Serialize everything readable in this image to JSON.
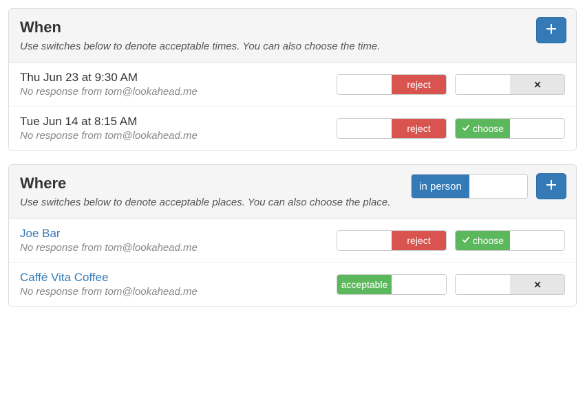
{
  "when": {
    "title": "When",
    "subtitle": "Use switches below to denote acceptable times.  You can also choose the time.",
    "items": [
      {
        "title": "Thu Jun 23 at 9:30 AM",
        "sub": "No response from tom@lookahead.me",
        "left": {
          "blank": "",
          "label": "reject",
          "color": "red"
        },
        "right": {
          "blank": "",
          "label": "✕",
          "color": "gray",
          "icon": "x"
        }
      },
      {
        "title": "Tue Jun 14 at 8:15 AM",
        "sub": "No response from tom@lookahead.me",
        "left": {
          "blank": "",
          "label": "reject",
          "color": "red"
        },
        "right": {
          "label": "choose",
          "blank": "",
          "color": "green",
          "icon": "check"
        }
      }
    ]
  },
  "where": {
    "title": "Where",
    "subtitle": "Use switches below to denote acceptable places.  You can also choose the place.",
    "mode_left": "in person",
    "mode_right": "",
    "items": [
      {
        "title": "Joe Bar",
        "sub": "No response from tom@lookahead.me",
        "left": {
          "blank": "",
          "label": "reject",
          "color": "red"
        },
        "right": {
          "label": "choose",
          "blank": "",
          "color": "green",
          "icon": "check"
        }
      },
      {
        "title": "Caffé Vita Coffee",
        "sub": "No response from tom@lookahead.me",
        "left": {
          "label": "acceptable",
          "blank": "",
          "color": "green"
        },
        "right": {
          "blank": "",
          "label": "✕",
          "color": "gray",
          "icon": "x"
        }
      }
    ]
  }
}
